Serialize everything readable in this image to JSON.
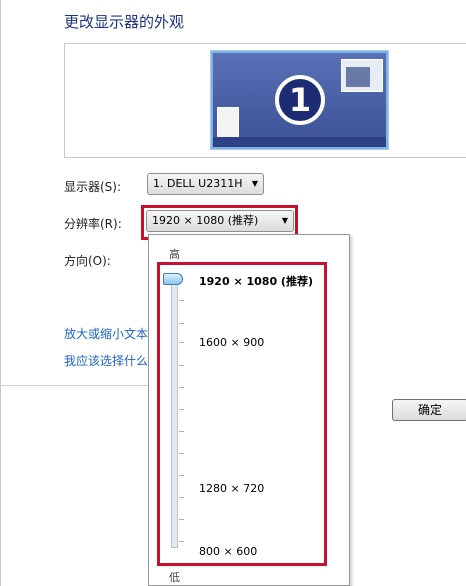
{
  "title": "更改显示器的外观",
  "preview": {
    "monitor_number": "1"
  },
  "display": {
    "label": "显示器(S):",
    "value": "1. DELL U2311H"
  },
  "resolution": {
    "label": "分辨率(R):",
    "value": "1920 × 1080 (推荐)",
    "dropdown": {
      "high_label": "高",
      "low_label": "低",
      "options": [
        "1920 × 1080 (推荐)",
        "1600 × 900",
        "1280 × 720",
        "800 × 600"
      ],
      "selected_index": 0
    }
  },
  "orientation": {
    "label": "方向(O):"
  },
  "links": [
    "放大或缩小文本",
    "我应该选择什么"
  ],
  "buttons": {
    "ok": "确定"
  },
  "colors": {
    "title": "#1e3287",
    "link": "#1e64c8",
    "highlight_border": "#c8102e"
  }
}
